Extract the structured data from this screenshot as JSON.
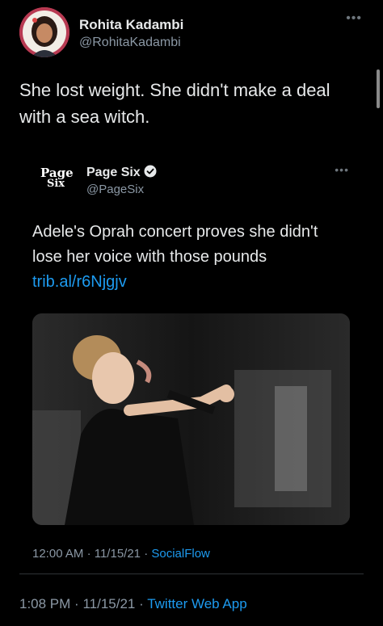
{
  "tweet": {
    "author_name": "Rohita Kadambi",
    "author_handle": "@RohitaKadambi",
    "more_icon": "more-horizontal-icon",
    "text": "She lost weight. She didn't make a deal with a sea witch.",
    "time": "1:08 PM",
    "date": "11/15/21",
    "separator": "·",
    "source": "Twitter Web App"
  },
  "quoted": {
    "logo_line1": "Page",
    "logo_line2": "Six",
    "name": "Page Six",
    "handle": "@PageSix",
    "verified": true,
    "text": "Adele's Oprah concert proves she didn't lose her voice with those pounds",
    "link": "trib.al/r6Njgjv",
    "time": "12:00 AM",
    "date": "11/15/21",
    "separator": "·",
    "source": "SocialFlow"
  },
  "colors": {
    "background": "#000000",
    "text": "#e7e9ea",
    "secondary": "#8b98a5",
    "link": "#1d9bf0"
  }
}
